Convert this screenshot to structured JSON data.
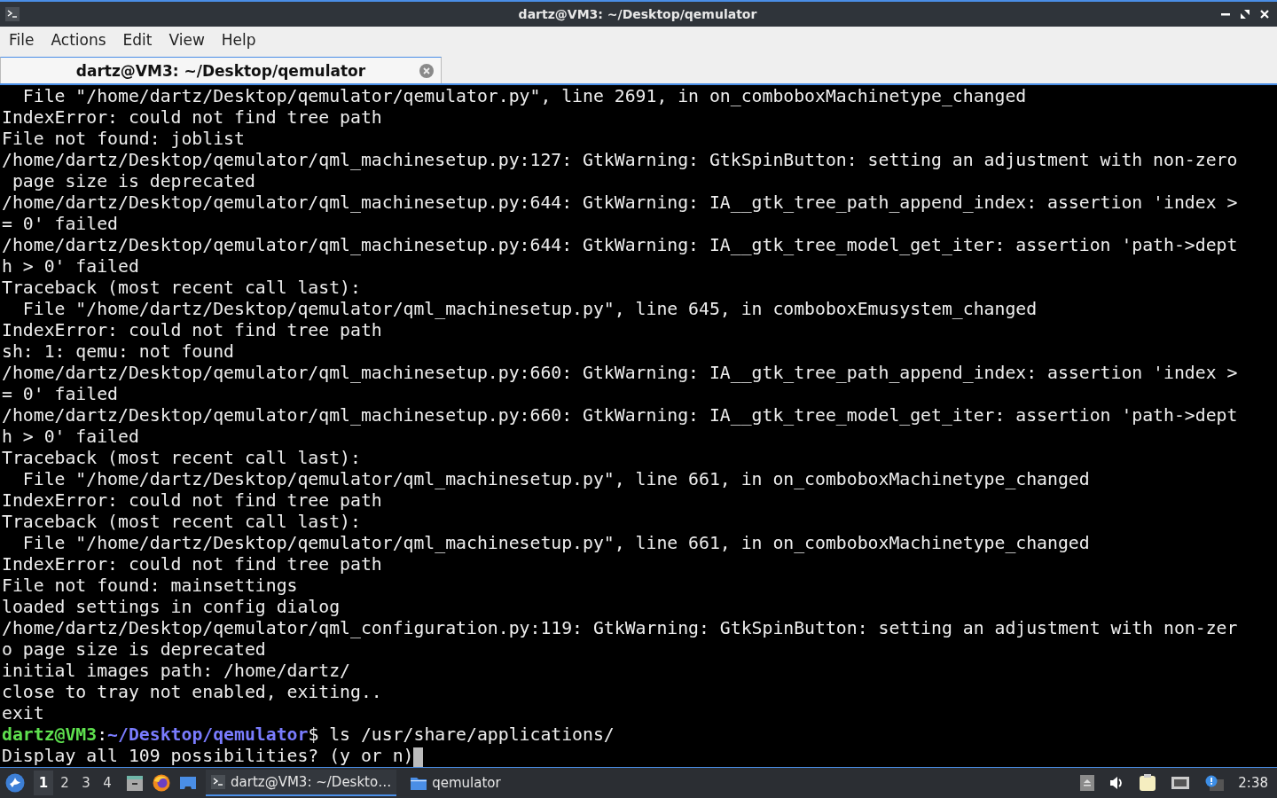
{
  "window": {
    "title": "dartz@VM3: ~/Desktop/qemulator"
  },
  "menu": [
    "File",
    "Actions",
    "Edit",
    "View",
    "Help"
  ],
  "tabs": [
    {
      "label": "dartz@VM3: ~/Desktop/qemulator",
      "selected": true
    }
  ],
  "terminal": {
    "lines": [
      "  File \"/home/dartz/Desktop/qemulator/qemulator.py\", line 2691, in on_comboboxMachinetype_changed",
      "IndexError: could not find tree path",
      "File not found: joblist",
      "/home/dartz/Desktop/qemulator/qml_machinesetup.py:127: GtkWarning: GtkSpinButton: setting an adjustment with non-zero",
      " page size is deprecated",
      "/home/dartz/Desktop/qemulator/qml_machinesetup.py:644: GtkWarning: IA__gtk_tree_path_append_index: assertion 'index >",
      "= 0' failed",
      "/home/dartz/Desktop/qemulator/qml_machinesetup.py:644: GtkWarning: IA__gtk_tree_model_get_iter: assertion 'path->dept",
      "h > 0' failed",
      "Traceback (most recent call last):",
      "  File \"/home/dartz/Desktop/qemulator/qml_machinesetup.py\", line 645, in comboboxEmusystem_changed",
      "IndexError: could not find tree path",
      "sh: 1: qemu: not found",
      "/home/dartz/Desktop/qemulator/qml_machinesetup.py:660: GtkWarning: IA__gtk_tree_path_append_index: assertion 'index >",
      "= 0' failed",
      "/home/dartz/Desktop/qemulator/qml_machinesetup.py:660: GtkWarning: IA__gtk_tree_model_get_iter: assertion 'path->dept",
      "h > 0' failed",
      "Traceback (most recent call last):",
      "  File \"/home/dartz/Desktop/qemulator/qml_machinesetup.py\", line 661, in on_comboboxMachinetype_changed",
      "IndexError: could not find tree path",
      "Traceback (most recent call last):",
      "  File \"/home/dartz/Desktop/qemulator/qml_machinesetup.py\", line 661, in on_comboboxMachinetype_changed",
      "IndexError: could not find tree path",
      "File not found: mainsettings",
      "loaded settings in config dialog",
      "/home/dartz/Desktop/qemulator/qml_configuration.py:119: GtkWarning: GtkSpinButton: setting an adjustment with non-zer",
      "o page size is deprecated",
      "initial images path: /home/dartz/",
      "close to tray not enabled, exiting..",
      "exit"
    ],
    "prompt": {
      "user_host": "dartz@VM3",
      "separator": ":",
      "path": "~/Desktop/qemulator",
      "command": "$ ls /usr/share/applications/"
    },
    "last_line": "Display all 109 possibilities? (y or n)"
  },
  "taskbar": {
    "workspaces": [
      {
        "label": "1",
        "selected": true
      },
      {
        "label": "2",
        "selected": false
      },
      {
        "label": "3",
        "selected": false
      },
      {
        "label": "4",
        "selected": false
      }
    ],
    "tasks": [
      {
        "kind": "terminal",
        "label": "dartz@VM3: ~/Deskto…",
        "selected": true
      },
      {
        "kind": "folder",
        "label": "qemulator",
        "selected": false
      }
    ],
    "clock": "2:38"
  }
}
